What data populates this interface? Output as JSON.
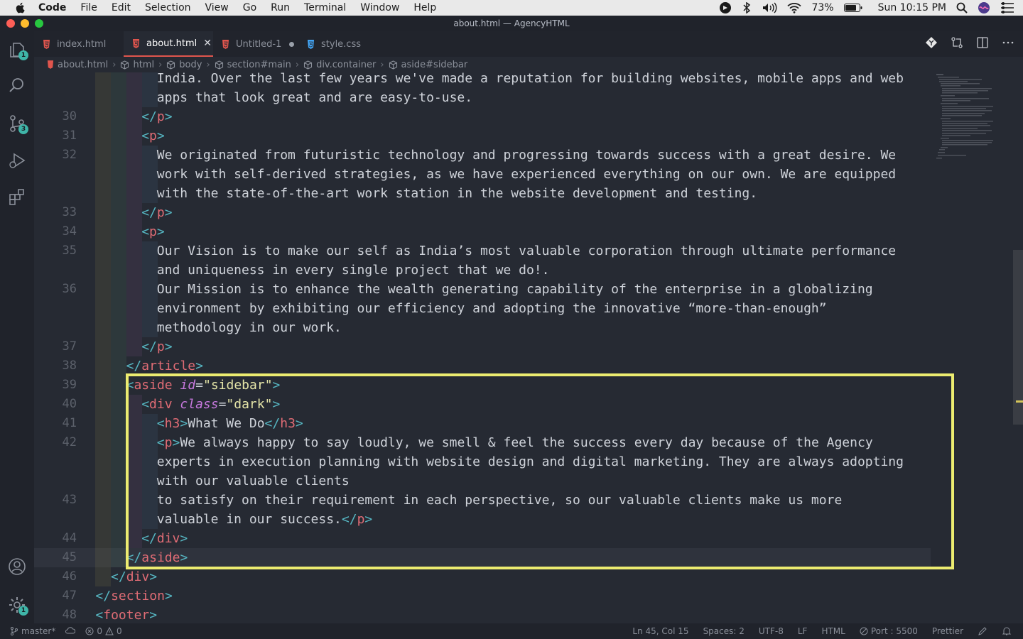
{
  "menubar": {
    "app": "Code",
    "items": [
      "File",
      "Edit",
      "Selection",
      "View",
      "Go",
      "Run",
      "Terminal",
      "Window",
      "Help"
    ],
    "battery": "73%",
    "clock": "Sun 10:15 PM"
  },
  "window": {
    "title": "about.html — AgencyHTML"
  },
  "activity": {
    "explorer_badge": "1",
    "scm_badge": "3",
    "settings_badge": "1"
  },
  "tabs": [
    {
      "label": "index.html"
    },
    {
      "label": "about.html"
    },
    {
      "label": "Untitled-1"
    },
    {
      "label": "style.css"
    }
  ],
  "breadcrumbs": [
    "about.html",
    "html",
    "body",
    "section#main",
    "div.container",
    "aside#sidebar"
  ],
  "editor": {
    "lines": [
      {
        "n": "",
        "t": "India. Over the last few years we've made a reputation for building websites, mobile apps and web"
      },
      {
        "n": "",
        "t": "apps that look great and are easy-to-use."
      },
      {
        "n": "30",
        "t": "</p>"
      },
      {
        "n": "31",
        "t": "<p>"
      },
      {
        "n": "32",
        "t": "We originated from futuristic technology and progressing towards success with a great desire. We"
      },
      {
        "n": "",
        "t": "work with self-derived strategies, as we have experienced everything on our own. We are equipped"
      },
      {
        "n": "",
        "t": "with the state-of-the-art work station in the website development and testing."
      },
      {
        "n": "33",
        "t": "</p>"
      },
      {
        "n": "34",
        "t": "<p>"
      },
      {
        "n": "35",
        "t": "Our Vision is to make our self as India’s most valuable corporation through ultimate performance"
      },
      {
        "n": "",
        "t": "and uniqueness in every single project that we do!."
      },
      {
        "n": "36",
        "t": "Our Mission is to enhance the wealth generating capability of the enterprise in a globalizing"
      },
      {
        "n": "",
        "t": "environment by exhibiting our efficiency and adopting the innovative “more-than-enough”"
      },
      {
        "n": "",
        "t": "methodology in our work."
      },
      {
        "n": "37",
        "t": "</p>"
      },
      {
        "n": "38",
        "t": "</article>"
      },
      {
        "n": "39",
        "t": "<aside id=\"sidebar\">"
      },
      {
        "n": "40",
        "t": "<div class=\"dark\">"
      },
      {
        "n": "41",
        "t": "<h3>What We Do</h3>"
      },
      {
        "n": "42",
        "t": "<p>We always happy to say loudly, we smell & feel the success every day because of the Agency"
      },
      {
        "n": "",
        "t": "experts in execution planning with website design and digital marketing. They are always adopting"
      },
      {
        "n": "",
        "t": "with our valuable clients"
      },
      {
        "n": "43",
        "t": "to satisfy on their requirement in each perspective, so our valuable clients make us more"
      },
      {
        "n": "",
        "t": "valuable in our success.</p>"
      },
      {
        "n": "44",
        "t": "</div>"
      },
      {
        "n": "45",
        "t": "</aside>"
      },
      {
        "n": "46",
        "t": "</div>"
      },
      {
        "n": "47",
        "t": "</section>"
      },
      {
        "n": "48",
        "t": "<footer>"
      }
    ]
  },
  "statusbar": {
    "branch": "master*",
    "errors": "0",
    "warnings": "0",
    "position": "Ln 45, Col 15",
    "spaces": "Spaces: 2",
    "encoding": "UTF-8",
    "eol": "LF",
    "language": "HTML",
    "port": "Port : 5500",
    "formatter": "Prettier"
  },
  "colors": {
    "highlight_box": "#ecec70",
    "tag": "#e06c75",
    "bracket": "#56b6c2",
    "attribute": "#c678dd",
    "string": "#e5e5a8",
    "badge": "#3fb5a8",
    "html_file_icon": "#e0554d",
    "css_file_icon": "#42a5f5"
  }
}
